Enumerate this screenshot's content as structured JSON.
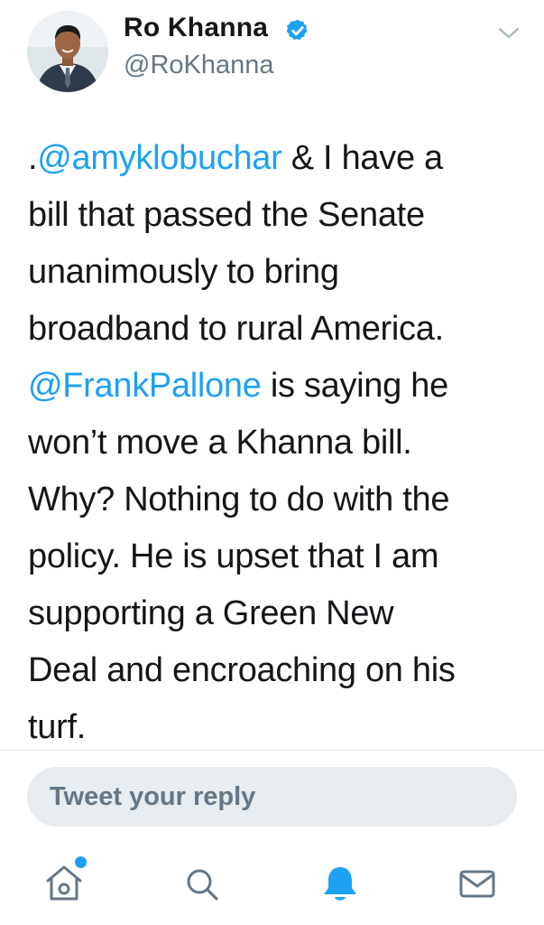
{
  "tweet": {
    "author": {
      "display_name": "Ro Khanna",
      "handle": "@RoKhanna",
      "verified": true
    },
    "text_lines": [
      [
        {
          "text": ".",
          "kind": "plain"
        },
        {
          "text": "@amyklobuchar",
          "kind": "mention"
        },
        {
          "text": " & I have a",
          "kind": "plain"
        }
      ],
      [
        {
          "text": "bill that passed the Senate",
          "kind": "plain"
        }
      ],
      [
        {
          "text": "unanimously to bring",
          "kind": "plain"
        }
      ],
      [
        {
          "text": "broadband to rural America.",
          "kind": "plain"
        }
      ],
      [
        {
          "text": "@FrankPallone",
          "kind": "mention"
        },
        {
          "text": " is saying he",
          "kind": "plain"
        }
      ],
      [
        {
          "text": "won’t move a Khanna bill.",
          "kind": "plain"
        }
      ],
      [
        {
          "text": "Why? Nothing to do with the",
          "kind": "plain"
        }
      ],
      [
        {
          "text": "policy. He is upset that I am",
          "kind": "plain"
        }
      ],
      [
        {
          "text": "supporting a Green New",
          "kind": "plain"
        }
      ],
      [
        {
          "text": "Deal and encroaching on his",
          "kind": "plain"
        }
      ],
      [
        {
          "text": "turf.",
          "kind": "plain"
        }
      ]
    ]
  },
  "reply": {
    "placeholder": "Tweet your reply"
  },
  "tab_bar": {
    "tabs": [
      {
        "name": "home",
        "icon": "home-icon",
        "has_badge_dot": true
      },
      {
        "name": "search",
        "icon": "search-icon",
        "has_badge_dot": false
      },
      {
        "name": "notifications",
        "icon": "bell-icon",
        "active": true
      },
      {
        "name": "messages",
        "icon": "envelope-icon",
        "has_badge_dot": false
      }
    ]
  },
  "colors": {
    "accent": "#1da1f2",
    "text_primary": "#14171a",
    "text_secondary": "#657786",
    "reply_box_bg": "#e6ecf0",
    "divider": "#e1e8ed"
  }
}
